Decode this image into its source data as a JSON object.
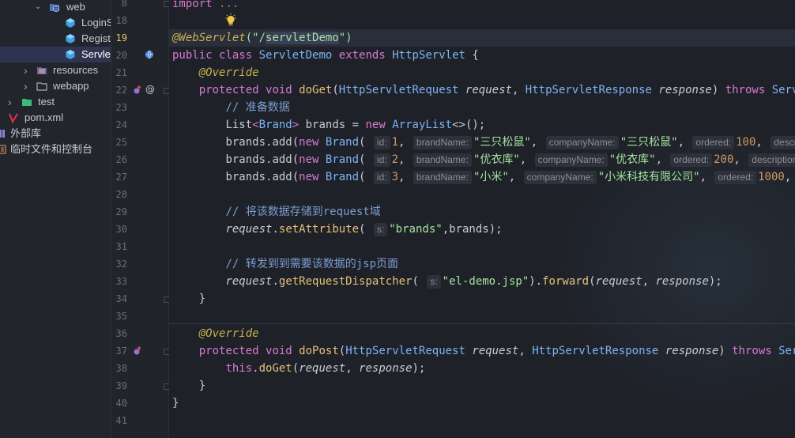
{
  "project_tree": {
    "items": [
      {
        "label": "web",
        "icon": "web-folder-icon",
        "arrow": "⌄",
        "selected": false
      },
      {
        "label": "LoginServlet",
        "icon": "java-class-icon",
        "arrow": "",
        "selected": false
      },
      {
        "label": "RegisterServlet",
        "icon": "java-class-icon",
        "arrow": "",
        "selected": false
      },
      {
        "label": "ServletDemo",
        "icon": "java-class-icon",
        "arrow": "",
        "selected": true
      },
      {
        "label": "resources",
        "icon": "resources-folder-icon",
        "arrow": "›",
        "selected": false
      },
      {
        "label": "webapp",
        "icon": "folder-icon",
        "arrow": "›",
        "selected": false
      },
      {
        "label": "test",
        "icon": "test-folder-icon",
        "arrow": "›",
        "selected": false
      },
      {
        "label": "pom.xml",
        "icon": "maven-icon",
        "arrow": "",
        "selected": false
      },
      {
        "label": "外部库",
        "icon": "library-icon",
        "arrow": "",
        "selected": false
      },
      {
        "label": "临时文件和控制台",
        "icon": "scratch-icon",
        "arrow": "",
        "selected": false
      }
    ]
  },
  "editor": {
    "current_line": "19",
    "line_numbers": [
      "8",
      "18",
      "19",
      "20",
      "21",
      "22",
      "23",
      "24",
      "25",
      "26",
      "27",
      "28",
      "29",
      "30",
      "31",
      "32",
      "33",
      "34",
      "35",
      "36",
      "37",
      "38",
      "39",
      "40",
      "41"
    ],
    "code": {
      "l8_import": "import",
      "l8_fold": "...",
      "l19_ann": "@WebServlet",
      "l19_open": "(\"/",
      "l19_sel": "servletDemo",
      "l19_close": "\")",
      "l20_kw1": "public",
      "l20_kw2": "class",
      "l20_name": "ServletDemo",
      "l20_kw3": "extends",
      "l20_super": "HttpServlet",
      "l20_brace": "{",
      "override": "@Override",
      "l22_kw1": "protected",
      "l22_kw2": "void",
      "l22_fn": "doGet",
      "l22_t1": "HttpServletRequest",
      "l22_p1": "request",
      "l22_t2": "HttpServletResponse",
      "l22_p2": "response",
      "l22_throws": "throws",
      "l22_ex": "ServletE",
      "l23_cmt": "// 准备数据",
      "l24_list": "List",
      "l24_brand": "Brand",
      "l24_var": "brands",
      "l24_new": "new",
      "l24_al": "ArrayList",
      "l24_end": "<>();",
      "add_call": "brands.add(",
      "new_kw": "new",
      "brand_cls": "Brand",
      "hint_id": "id:",
      "hint_brandName": "brandName:",
      "hint_companyName": "companyName:",
      "hint_ordered": "ordered:",
      "hint_description": "description:",
      "hint_desc_cut": "desc",
      "r1_id": "1",
      "r1_bn": "\"三只松鼠\"",
      "r1_cn": "\"三只松鼠\"",
      "r1_ord": "100",
      "r1_desc": "descriptio",
      "r2_id": "2",
      "r2_bn": "\"优衣库\"",
      "r2_cn": "\"优衣库\"",
      "r2_ord": "200",
      "r2_tail": "\"",
      "r3_id": "3",
      "r3_bn": "\"小米\"",
      "r3_cn": "\"小米科技有限公司\"",
      "r3_ord": "1000",
      "l29_cmt": "// 将该数据存储到request域",
      "l30_req": "request",
      "l30_fn": "setAttribute",
      "hint_s": "s:",
      "l30_str": "\"brands\"",
      "l30_end": ",brands);",
      "l32_cmt": "// 转发到到需要该数据的jsp页面",
      "l33_req": "request",
      "l33_fn": "getRequestDispatcher",
      "l33_str": "\"el-demo.jsp\"",
      "l33_fwd": "forward",
      "l33_p1": "request",
      "l33_p2": "response",
      "close_brace": "}",
      "l37_fn": "doPost",
      "l37_ex": "Servlet",
      "l38_this": "this",
      "l38_fn": "doGet",
      "l38_p1": "request",
      "l38_p2": "response"
    }
  },
  "colors": {
    "background": "#1f2128",
    "keyword": "#d77ad3",
    "annotation": "#c7b24a",
    "string": "#a3e4a0",
    "number": "#d19a66",
    "type": "#7cb4f7",
    "method": "#e5c07b",
    "comment": "#7a9dd0"
  }
}
